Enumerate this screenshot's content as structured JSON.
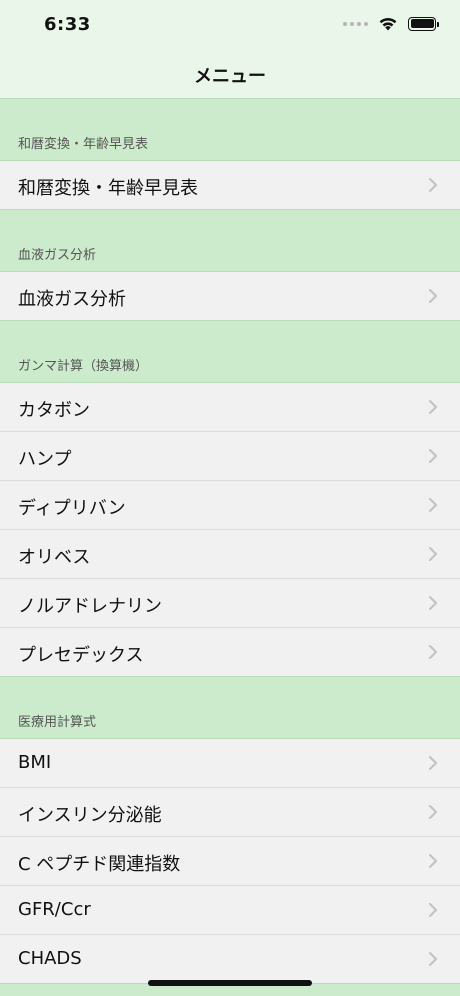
{
  "status_bar": {
    "time": "6:33"
  },
  "nav": {
    "title": "メニュー"
  },
  "sections": [
    {
      "header": "和暦変換・年齢早見表",
      "items": [
        "和暦変換・年齢早見表"
      ]
    },
    {
      "header": "血液ガス分析",
      "items": [
        "血液ガス分析"
      ]
    },
    {
      "header": "ガンマ計算（換算機）",
      "items": [
        "カタボン",
        "ハンプ",
        "ディプリバン",
        "オリベス",
        "ノルアドレナリン",
        "プレセデックス"
      ]
    },
    {
      "header": "医療用計算式",
      "items": [
        "BMI",
        "インスリン分泌能",
        "C ペプチド関連指数",
        "GFR/Ccr",
        "CHADS"
      ]
    }
  ],
  "colors": {
    "header_bg": "#ccebcc",
    "topbar_bg": "#eaf6ea",
    "row_bg": "#f1f1f2",
    "chevron": "#c4c4c7"
  },
  "icons": {
    "chevron": "chevron-right-icon",
    "wifi": "wifi-icon",
    "battery": "battery-icon",
    "cellular": "cellular-signal-icon"
  }
}
